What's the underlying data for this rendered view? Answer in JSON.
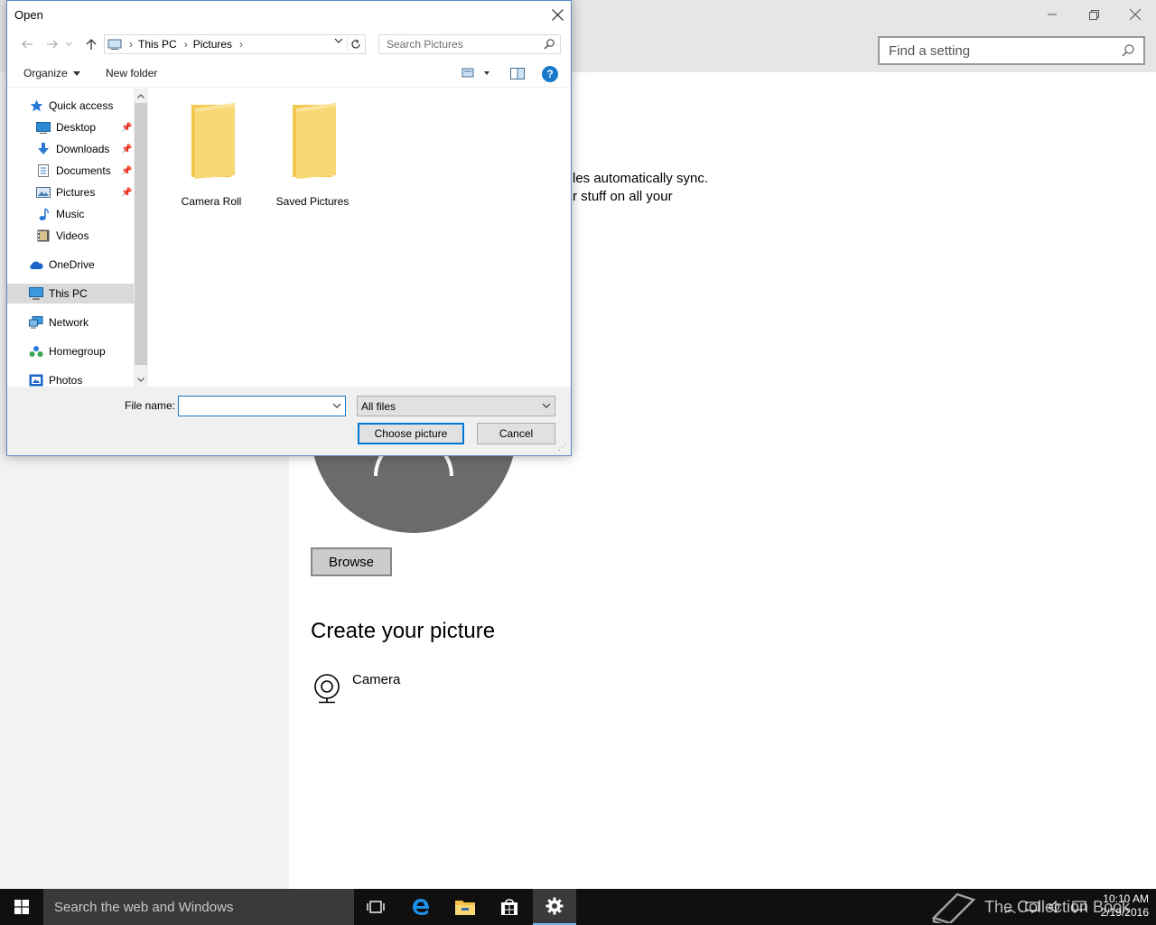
{
  "settings": {
    "find_placeholder": "Find a setting",
    "sync_line1": "les automatically sync.",
    "sync_line2": "r stuff on all your",
    "browse_label": "Browse",
    "create_title": "Create your picture",
    "camera_label": "Camera"
  },
  "dialog": {
    "title": "Open",
    "breadcrumb": [
      "This PC",
      "Pictures"
    ],
    "search_placeholder": "Search Pictures",
    "toolbar": {
      "organize": "Organize",
      "new_folder": "New folder"
    },
    "nav": {
      "quick_access": "Quick access",
      "desktop": "Desktop",
      "downloads": "Downloads",
      "documents": "Documents",
      "pictures": "Pictures",
      "music": "Music",
      "videos": "Videos",
      "onedrive": "OneDrive",
      "this_pc": "This PC",
      "network": "Network",
      "homegroup": "Homegroup",
      "photos": "Photos"
    },
    "folders": [
      "Camera Roll",
      "Saved Pictures"
    ],
    "file_name_label": "File name:",
    "file_name_value": "",
    "file_type": "All files",
    "choose_label": "Choose picture",
    "cancel_label": "Cancel"
  },
  "taskbar": {
    "search_placeholder": "Search the web and Windows",
    "watermark": "The Collection Book",
    "time": "10:10 AM",
    "date": "2/19/2016"
  },
  "colors": {
    "accent": "#0078d7",
    "folder": "#f8d775",
    "taskbar": "#101010"
  }
}
